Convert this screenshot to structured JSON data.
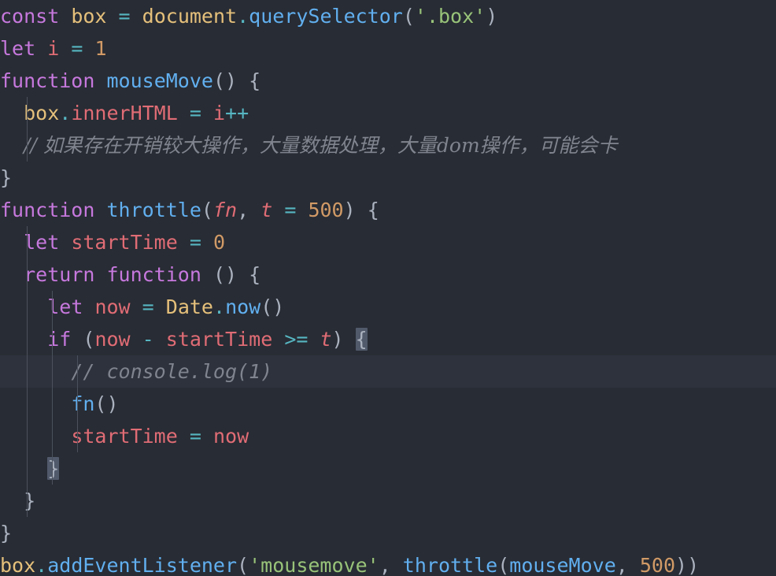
{
  "editor": {
    "theme_name": "one-dark",
    "background_color": "#282c34",
    "active_line_color": "#2e323d",
    "language": "javascript",
    "font_size_px": 25,
    "line_height_px": 41,
    "active_line_index": 9,
    "colors": {
      "keyword": "#c678dd",
      "variable": "#e5c07b",
      "property": "#61afef",
      "identifier": "#e06c75",
      "number": "#d19a66",
      "string": "#98c379",
      "operator": "#56b6c2",
      "punctuation": "#abb2bf",
      "comment": "#7f848e",
      "brace_match_bg": "#515a6b",
      "indent_guide": "#4b515d"
    }
  },
  "code": {
    "lines": [
      {
        "index": 0,
        "indent": 0,
        "text": "const box = document.querySelector('.box')",
        "tokens": [
          {
            "t": "const",
            "c": "kw"
          },
          {
            "t": " ",
            "c": "punc"
          },
          {
            "t": "box",
            "c": "var"
          },
          {
            "t": " ",
            "c": "punc"
          },
          {
            "t": "=",
            "c": "op"
          },
          {
            "t": " ",
            "c": "punc"
          },
          {
            "t": "document",
            "c": "var"
          },
          {
            "t": ".",
            "c": "op"
          },
          {
            "t": "querySelector",
            "c": "prop"
          },
          {
            "t": "(",
            "c": "punc"
          },
          {
            "t": "'.box'",
            "c": "str"
          },
          {
            "t": ")",
            "c": "punc"
          }
        ]
      },
      {
        "index": 1,
        "indent": 0,
        "text": "let i = 1",
        "tokens": [
          {
            "t": "let",
            "c": "kw"
          },
          {
            "t": " ",
            "c": "punc"
          },
          {
            "t": "i",
            "c": "ident"
          },
          {
            "t": " ",
            "c": "punc"
          },
          {
            "t": "=",
            "c": "op"
          },
          {
            "t": " ",
            "c": "punc"
          },
          {
            "t": "1",
            "c": "num"
          }
        ]
      },
      {
        "index": 2,
        "indent": 0,
        "text": "function mouseMove() {",
        "tokens": [
          {
            "t": "function",
            "c": "kw"
          },
          {
            "t": " ",
            "c": "punc"
          },
          {
            "t": "mouseMove",
            "c": "fn"
          },
          {
            "t": "() {",
            "c": "punc"
          }
        ]
      },
      {
        "index": 3,
        "indent": 1,
        "text": "  box.innerHTML = i++",
        "tokens": [
          {
            "t": "  ",
            "c": "punc"
          },
          {
            "t": "box",
            "c": "var"
          },
          {
            "t": ".",
            "c": "op"
          },
          {
            "t": "innerHTML",
            "c": "ident"
          },
          {
            "t": " ",
            "c": "punc"
          },
          {
            "t": "=",
            "c": "op"
          },
          {
            "t": " ",
            "c": "punc"
          },
          {
            "t": "i",
            "c": "ident"
          },
          {
            "t": "++",
            "c": "op"
          }
        ]
      },
      {
        "index": 4,
        "indent": 1,
        "text": "  // 如果存在开销较大操作，大量数据处理，大量dom操作，可能会卡",
        "tokens": [
          {
            "t": "  ",
            "c": "punc"
          },
          {
            "t": "// 如果存在开销较大操作，大量数据处理，大量dom操作，可能会卡",
            "c": "cmt-cn"
          }
        ]
      },
      {
        "index": 5,
        "indent": 0,
        "text": "}",
        "tokens": [
          {
            "t": "}",
            "c": "punc"
          }
        ]
      },
      {
        "index": 6,
        "indent": 0,
        "text": "function throttle(fn, t = 500) {",
        "tokens": [
          {
            "t": "function",
            "c": "kw"
          },
          {
            "t": " ",
            "c": "punc"
          },
          {
            "t": "throttle",
            "c": "fn"
          },
          {
            "t": "(",
            "c": "punc"
          },
          {
            "t": "fn",
            "c": "param"
          },
          {
            "t": ", ",
            "c": "punc"
          },
          {
            "t": "t",
            "c": "param"
          },
          {
            "t": " ",
            "c": "punc"
          },
          {
            "t": "=",
            "c": "op"
          },
          {
            "t": " ",
            "c": "punc"
          },
          {
            "t": "500",
            "c": "num"
          },
          {
            "t": ") {",
            "c": "punc"
          }
        ]
      },
      {
        "index": 7,
        "indent": 1,
        "text": "  let startTime = 0",
        "tokens": [
          {
            "t": "  ",
            "c": "punc"
          },
          {
            "t": "let",
            "c": "kw"
          },
          {
            "t": " ",
            "c": "punc"
          },
          {
            "t": "startTime",
            "c": "ident"
          },
          {
            "t": " ",
            "c": "punc"
          },
          {
            "t": "=",
            "c": "op"
          },
          {
            "t": " ",
            "c": "punc"
          },
          {
            "t": "0",
            "c": "num"
          }
        ]
      },
      {
        "index": 8,
        "indent": 1,
        "text": "  return function () {",
        "tokens": [
          {
            "t": "  ",
            "c": "punc"
          },
          {
            "t": "return",
            "c": "kw"
          },
          {
            "t": " ",
            "c": "punc"
          },
          {
            "t": "function",
            "c": "kw"
          },
          {
            "t": " () {",
            "c": "punc"
          }
        ]
      },
      {
        "index": 9,
        "indent": 2,
        "text": "    let now = Date.now()",
        "tokens": [
          {
            "t": "    ",
            "c": "punc"
          },
          {
            "t": "let",
            "c": "kw"
          },
          {
            "t": " ",
            "c": "punc"
          },
          {
            "t": "now",
            "c": "ident"
          },
          {
            "t": " ",
            "c": "punc"
          },
          {
            "t": "=",
            "c": "op"
          },
          {
            "t": " ",
            "c": "punc"
          },
          {
            "t": "Date",
            "c": "var"
          },
          {
            "t": ".",
            "c": "op"
          },
          {
            "t": "now",
            "c": "prop"
          },
          {
            "t": "()",
            "c": "punc"
          }
        ]
      },
      {
        "index": 10,
        "indent": 2,
        "text": "    if (now - startTime >= t) {",
        "tokens": [
          {
            "t": "    ",
            "c": "punc"
          },
          {
            "t": "if",
            "c": "kw"
          },
          {
            "t": " (",
            "c": "punc"
          },
          {
            "t": "now",
            "c": "ident"
          },
          {
            "t": " ",
            "c": "punc"
          },
          {
            "t": "-",
            "c": "op"
          },
          {
            "t": " ",
            "c": "punc"
          },
          {
            "t": "startTime",
            "c": "ident"
          },
          {
            "t": " ",
            "c": "punc"
          },
          {
            "t": ">=",
            "c": "op"
          },
          {
            "t": " ",
            "c": "punc"
          },
          {
            "t": "t",
            "c": "param"
          },
          {
            "t": ") ",
            "c": "punc"
          },
          {
            "t": "{",
            "c": "punc",
            "match": true
          }
        ]
      },
      {
        "index": 11,
        "indent": 3,
        "text": "      // console.log(1)",
        "active": true,
        "tokens": [
          {
            "t": "      ",
            "c": "punc"
          },
          {
            "t": "// console.log(1)",
            "c": "cmt"
          }
        ]
      },
      {
        "index": 12,
        "indent": 3,
        "text": "      fn()",
        "tokens": [
          {
            "t": "      ",
            "c": "punc"
          },
          {
            "t": "fn",
            "c": "fn"
          },
          {
            "t": "()",
            "c": "punc"
          }
        ]
      },
      {
        "index": 13,
        "indent": 3,
        "text": "      startTime = now",
        "tokens": [
          {
            "t": "      ",
            "c": "punc"
          },
          {
            "t": "startTime",
            "c": "ident"
          },
          {
            "t": " ",
            "c": "punc"
          },
          {
            "t": "=",
            "c": "op"
          },
          {
            "t": " ",
            "c": "punc"
          },
          {
            "t": "now",
            "c": "ident"
          }
        ]
      },
      {
        "index": 14,
        "indent": 2,
        "text": "    }",
        "tokens": [
          {
            "t": "    ",
            "c": "punc"
          },
          {
            "t": "}",
            "c": "punc",
            "match": true
          }
        ]
      },
      {
        "index": 15,
        "indent": 1,
        "text": "  }",
        "tokens": [
          {
            "t": "  ",
            "c": "punc"
          },
          {
            "t": "}",
            "c": "punc"
          }
        ]
      },
      {
        "index": 16,
        "indent": 0,
        "text": "}",
        "tokens": [
          {
            "t": "}",
            "c": "punc"
          }
        ]
      },
      {
        "index": 17,
        "indent": 0,
        "text": "box.addEventListener('mousemove', throttle(mouseMove, 500))",
        "tokens": [
          {
            "t": "box",
            "c": "var"
          },
          {
            "t": ".",
            "c": "op"
          },
          {
            "t": "addEventListener",
            "c": "prop"
          },
          {
            "t": "(",
            "c": "punc"
          },
          {
            "t": "'mousemove'",
            "c": "str"
          },
          {
            "t": ", ",
            "c": "punc"
          },
          {
            "t": "throttle",
            "c": "fn"
          },
          {
            "t": "(",
            "c": "punc"
          },
          {
            "t": "mouseMove",
            "c": "prop"
          },
          {
            "t": ", ",
            "c": "punc"
          },
          {
            "t": "500",
            "c": "num"
          },
          {
            "t": "))",
            "c": "punc"
          }
        ]
      }
    ]
  }
}
